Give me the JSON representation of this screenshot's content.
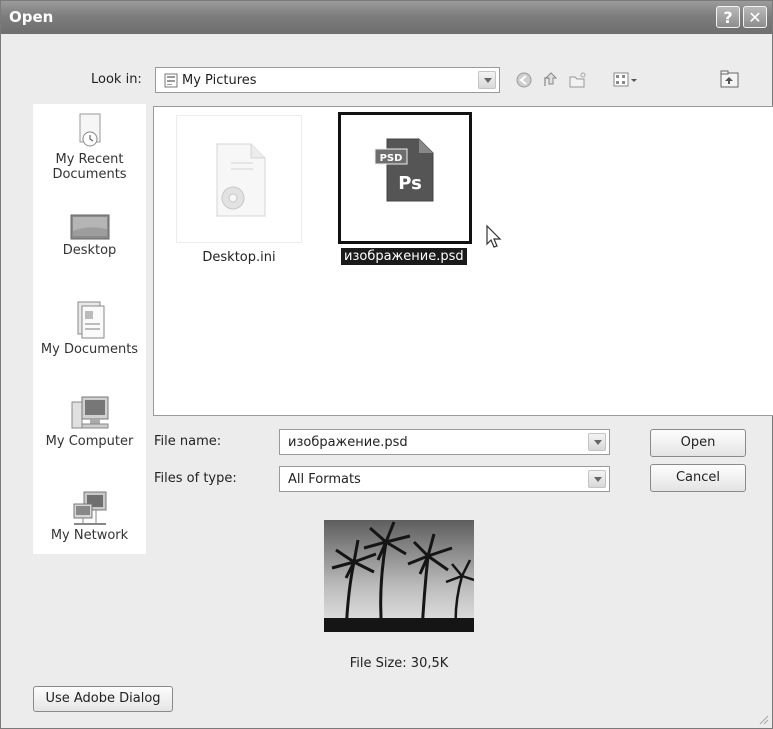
{
  "window": {
    "title": "Open",
    "help_glyph": "?",
    "close_glyph": "✕"
  },
  "look_in": {
    "label": "Look in:",
    "value": "My Pictures"
  },
  "places": [
    {
      "label_line1": "My Recent",
      "label_line2": "Documents"
    },
    {
      "label_line1": "Desktop"
    },
    {
      "label_line1": "My Documents"
    },
    {
      "label_line1": "My Computer"
    },
    {
      "label_line1": "My Network"
    }
  ],
  "files": [
    {
      "name": "Desktop.ini",
      "selected": false
    },
    {
      "name": "изображение.psd",
      "selected": true,
      "badge": "PSD",
      "logo": "Ps"
    }
  ],
  "file_name": {
    "label": "File name:",
    "value": "изображение.psd"
  },
  "file_type": {
    "label": "Files of type:",
    "value": "All Formats"
  },
  "buttons": {
    "open": "Open",
    "cancel": "Cancel",
    "adobe_dialog": "Use Adobe Dialog"
  },
  "preview": {
    "file_size": "File Size: 30,5K"
  },
  "icons": [
    "back-icon",
    "up-folder-icon",
    "new-folder-icon",
    "views-menu-icon",
    "adobe-bridge-icon"
  ]
}
